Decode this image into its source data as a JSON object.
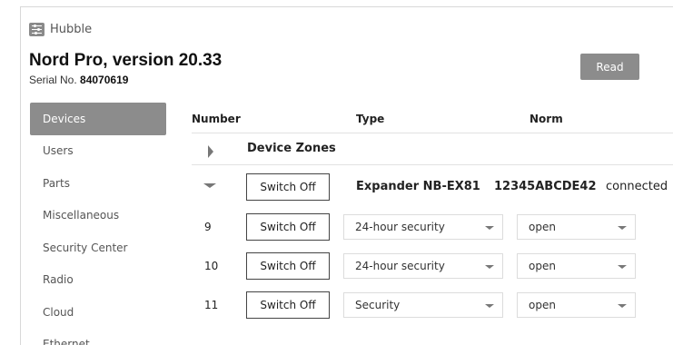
{
  "app": {
    "name": "Hubble",
    "icon": "settings-sliders-icon"
  },
  "header": {
    "title": "Nord Pro, version 20.33",
    "serial_label": "Serial No.",
    "serial_value": "84070619",
    "read_button": "Read"
  },
  "sidebar": {
    "items": [
      {
        "label": "Devices",
        "active": true
      },
      {
        "label": "Users"
      },
      {
        "label": "Parts"
      },
      {
        "label": "Miscellaneous"
      },
      {
        "label": "Security Center"
      },
      {
        "label": "Radio"
      },
      {
        "label": "Cloud"
      },
      {
        "label": "Ethernet"
      }
    ]
  },
  "table": {
    "columns": {
      "number": "Number",
      "type": "Type",
      "norm": "Norm"
    },
    "group": {
      "label": "Device Zones",
      "icon": "chevron-right-icon"
    },
    "expander": {
      "icon": "chevron-down-icon",
      "switch_label": "Switch Off",
      "name": "Expander NB-EX81",
      "id": "12345ABCDE42",
      "status": "connected"
    },
    "rows": [
      {
        "number": "9",
        "switch_label": "Switch Off",
        "type": "24-hour security",
        "norm": "open"
      },
      {
        "number": "10",
        "switch_label": "Switch Off",
        "type": "24-hour security",
        "norm": "open"
      },
      {
        "number": "11",
        "switch_label": "Switch Off",
        "type": "Security",
        "norm": "open"
      }
    ]
  },
  "colors": {
    "accent_gray": "#8c8c8c",
    "border": "#dcdcdc"
  }
}
